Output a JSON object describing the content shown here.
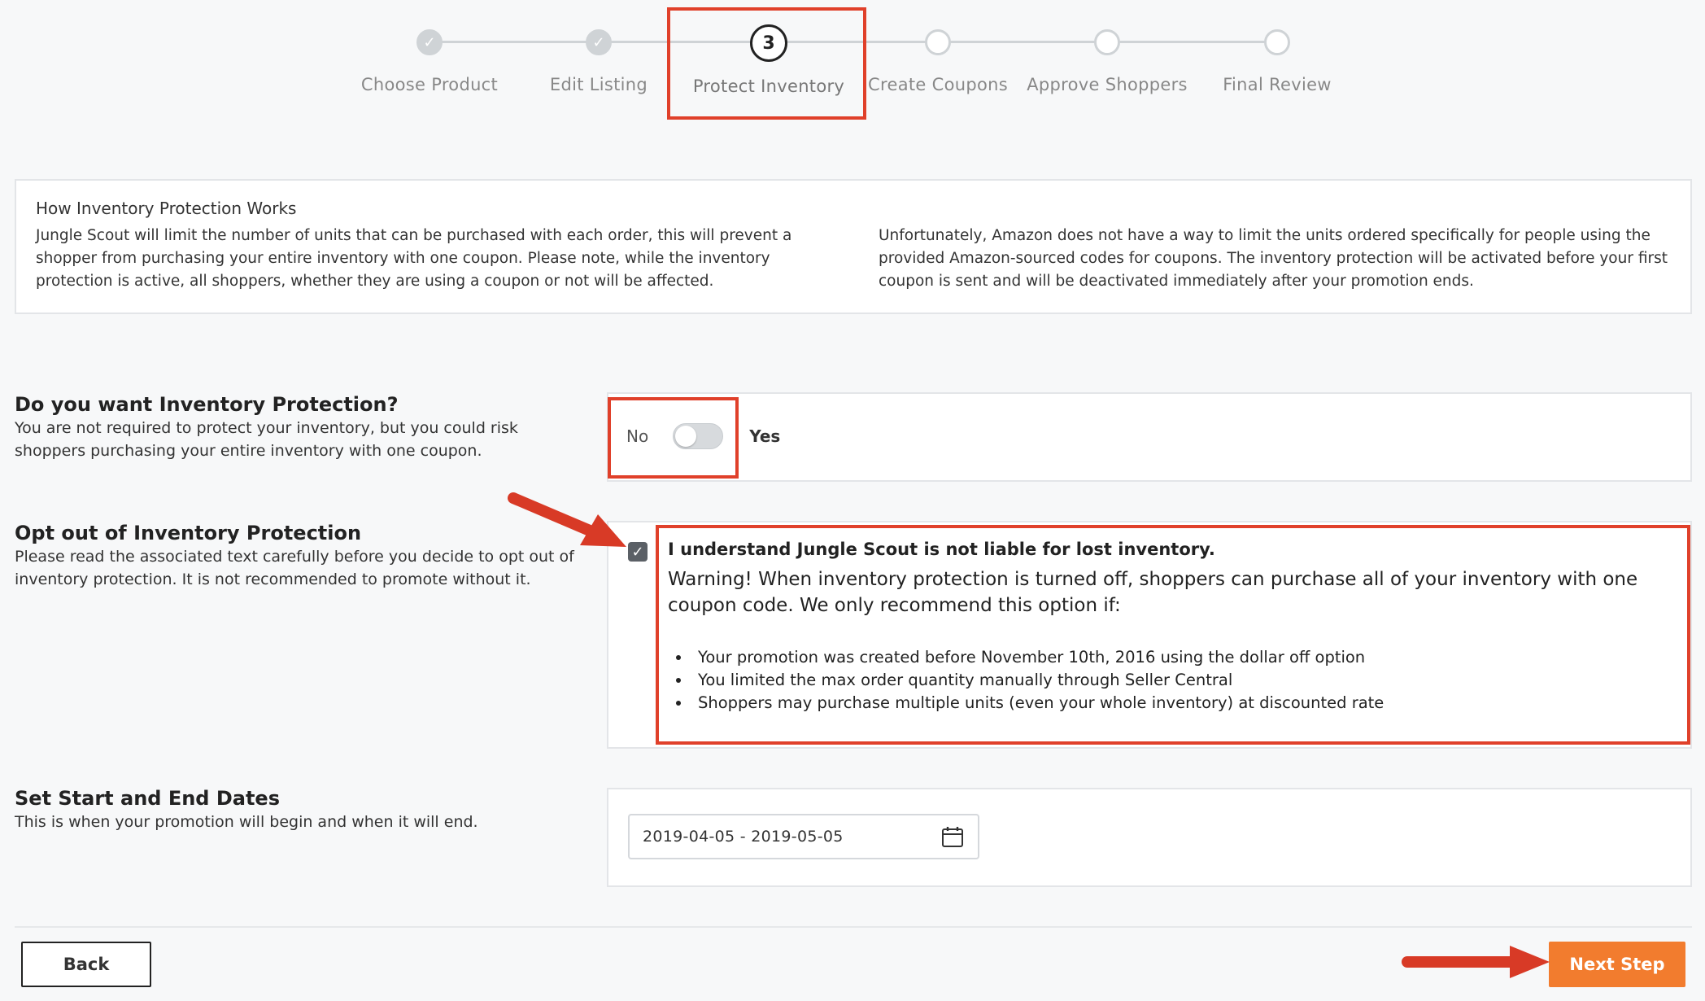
{
  "steps": [
    {
      "label": "Choose Product",
      "state": "done"
    },
    {
      "label": "Edit Listing",
      "state": "done"
    },
    {
      "label": "Protect Inventory",
      "state": "current",
      "number": "3"
    },
    {
      "label": "Create Coupons",
      "state": "todo"
    },
    {
      "label": "Approve Shoppers",
      "state": "todo"
    },
    {
      "label": "Final Review",
      "state": "todo"
    }
  ],
  "info": {
    "title": "How Inventory Protection Works",
    "left": "Jungle Scout will limit the number of units that can be purchased with each order, this will prevent a shopper from purchasing your entire inventory with one coupon. Please note, while the inventory protection is active, all shoppers, whether they are using a coupon or not will be affected.",
    "right": "Unfortunately, Amazon does not have a way to limit the units ordered specifically for people using the provided Amazon-sourced codes for coupons. The inventory protection will be activated before your first coupon is sent and will be deactivated immediately after your promotion ends."
  },
  "protection": {
    "title": "Do you want Inventory Protection?",
    "desc": "You are not required to protect your inventory, but you could risk shoppers purchasing your entire inventory with one coupon.",
    "no_label": "No",
    "yes_label": "Yes",
    "enabled": false
  },
  "optout": {
    "title": "Opt out of Inventory Protection",
    "desc": "Please read the associated text carefully before you decide to opt out of inventory protection. It is not recommended to promote without it.",
    "checked": true,
    "agree_text": "I understand Jungle Scout is not liable for lost inventory.",
    "warning": "Warning! When inventory protection is turned off, shoppers can purchase all of your inventory with one coupon code. We only recommend this option if:",
    "bullets": [
      "Your promotion was created before November 10th, 2016 using the dollar off option",
      "You limited the max order quantity manually through Seller Central",
      "Shoppers may purchase multiple units (even your whole inventory) at discounted rate"
    ]
  },
  "dates": {
    "title": "Set Start and End Dates",
    "desc": "This is when your promotion will begin and when it will end.",
    "value": "2019-04-05 - 2019-05-05",
    "icon": "calendar-icon"
  },
  "footer": {
    "back_label": "Back",
    "next_label": "Next Step"
  },
  "colors": {
    "accent": "#f27c2e",
    "highlight": "#e0402a"
  }
}
